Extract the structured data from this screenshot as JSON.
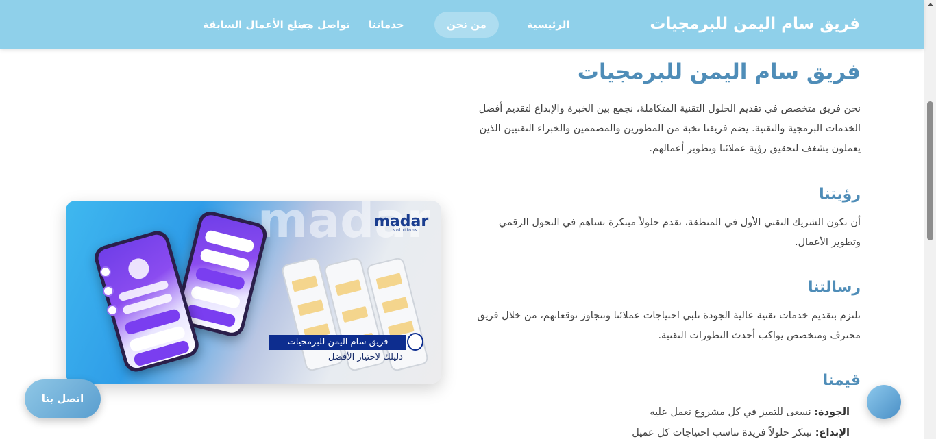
{
  "header": {
    "brand": "فريق سام اليمن للبرمجيات",
    "nav": [
      {
        "label": "الرئيسية",
        "active": false
      },
      {
        "label": "من نحن",
        "active": true
      },
      {
        "label": "خدماتنا",
        "active": false
      },
      {
        "label": "تواصل معنا",
        "active": false
      },
      {
        "label": "جميع الأعمال السابقة",
        "active": false
      }
    ]
  },
  "about": {
    "title": "فريق سام اليمن للبرمجيات",
    "intro": "نحن فريق متخصص في تقديم الحلول التقنية المتكاملة، نجمع بين الخبرة والإبداع لتقديم أفضل الخدمات البرمجية والتقنية. يضم فريقنا نخبة من المطورين والمصممين والخبراء التقنيين الذين يعملون بشغف لتحقيق رؤية عملائنا وتطوير أعمالهم."
  },
  "vision": {
    "title": "رؤيتنا",
    "text": "أن نكون الشريك التقني الأول في المنطقة، نقدم حلولاً مبتكرة تساهم في التحول الرقمي وتطوير الأعمال."
  },
  "mission": {
    "title": "رسالتنا",
    "text": "نلتزم بتقديم خدمات تقنية عالية الجودة تلبي احتياجات عملائنا وتتجاوز توقعاتهم، من خلال فريق محترف ومتخصص يواكب أحدث التطورات التقنية."
  },
  "values": {
    "title": "قيمنا",
    "items": [
      {
        "label": "الجودة:",
        "text": " نسعى للتميز في كل مشروع نعمل عليه"
      },
      {
        "label": "الإبداع:",
        "text": " نبتكر حلولاً فريدة تناسب احتياجات كل عميل"
      }
    ]
  },
  "image": {
    "logo": "madar",
    "logo_sub": "solutions",
    "bg_word": "madar",
    "banner_title": "فريق سام اليمن للبرمجيات",
    "banner_subtitle": "دليلك لاختيار الأفضل"
  },
  "floating": {
    "contact_label": "اتصل بنا"
  },
  "colors": {
    "header_bg": "#8fd0ea",
    "heading": "#4f8db8",
    "button": "#5a9ecf"
  }
}
